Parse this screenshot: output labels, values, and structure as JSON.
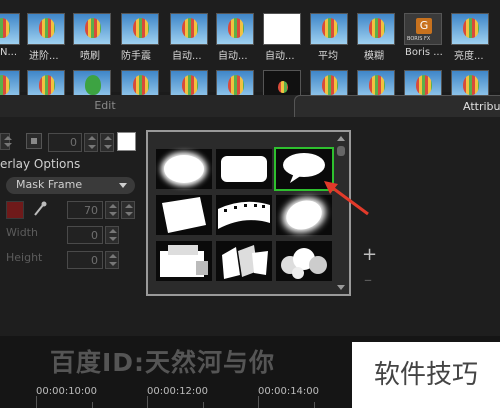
{
  "effects": {
    "row1_labels": [
      "N...",
      "进阶...",
      "喷刷",
      "防手震",
      "自动...",
      "自动...",
      "自动...",
      "平均",
      "模糊",
      "Boris ...",
      "亮度..."
    ],
    "boris_logo_text": "BORIS FX"
  },
  "tabs": {
    "edit": "Edit",
    "attributes": "Attribu"
  },
  "overlay": {
    "options_label": "erlay Options",
    "frame_value": "0",
    "mask_select": "Mask Frame",
    "opacity_value": "70",
    "width_label": "Width",
    "width_value": "0",
    "height_label": "Height",
    "height_value": "0",
    "mask_color": "#6f1a1a"
  },
  "side": {
    "plus": "+",
    "minus": "–"
  },
  "timeline": {
    "timecodes": [
      "00:00:10:00",
      "00:00:12:00",
      "00:00:14:00"
    ]
  },
  "watermark": {
    "text": "百度ID:天然河与你",
    "box_text": "软件技巧"
  }
}
